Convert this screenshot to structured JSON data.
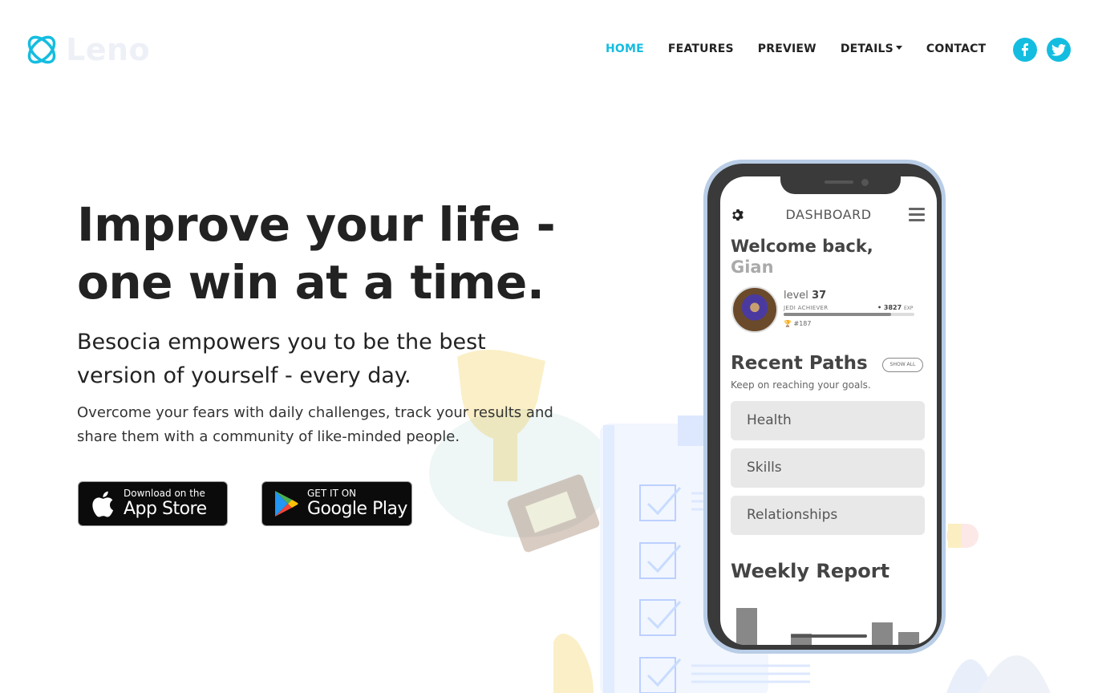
{
  "brand": {
    "name": "Leno",
    "accent": "#14bde0"
  },
  "nav": {
    "items": [
      {
        "label": "HOME",
        "active": true
      },
      {
        "label": "FEATURES",
        "active": false
      },
      {
        "label": "PREVIEW",
        "active": false
      },
      {
        "label": "DETAILS",
        "active": false,
        "dropdown": true
      },
      {
        "label": "CONTACT",
        "active": false
      }
    ],
    "social": [
      "facebook-icon",
      "twitter-icon"
    ]
  },
  "hero": {
    "title_line1": "Improve your life -",
    "title_line2": "one win at a time.",
    "subtitle_line1": "Besocia empowers you to be the best",
    "subtitle_line2": "version of yourself - every day.",
    "body_line1": "Overcome your fears with daily challenges, track your results and",
    "body_line2": "share them with a community of like-minded people.",
    "app_store": {
      "small": "Download on the",
      "big": "App Store"
    },
    "google_play": {
      "small": "GET IT ON",
      "big": "Google Play"
    }
  },
  "phone": {
    "header": "DASHBOARD",
    "welcome": "Welcome back,",
    "username": "Gian",
    "level_label": "level",
    "level_value": "37",
    "rank_title": "JEDI ACHIEVER",
    "exp_value": "• 3827",
    "exp_unit": "EXP",
    "exp_progress": 0.82,
    "rank": "#187",
    "recent_title": "Recent Paths",
    "show_all": "SHOW ALL",
    "recent_sub": "Keep on reaching your goals.",
    "paths": [
      "Health",
      "Skills",
      "Relationships"
    ],
    "weekly_title": "Weekly Report"
  }
}
